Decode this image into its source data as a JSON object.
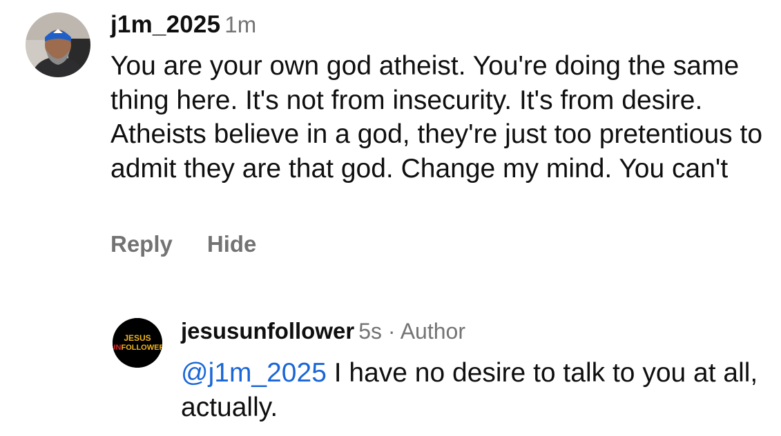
{
  "comments": [
    {
      "username": "j1m_2025",
      "time": "1m",
      "text": "You are your own god atheist. You're doing the same thing here. It's not from insecurity. It's from desire. Atheists believe in a god, they're just too pretentious to admit they are that god. Change my mind. You can't",
      "actions": {
        "reply": "Reply",
        "hide": "Hide"
      }
    }
  ],
  "reply": {
    "username": "jesusunfollower",
    "time": "5s",
    "separator": "·",
    "author_badge": "Author",
    "mention": "@j1m_2025",
    "text": " I have no desire to talk to you at all, actually.",
    "avatar_logo": {
      "line1": "JESUS",
      "line2_accent": "UN",
      "line2_rest": "FOLLOWER"
    }
  },
  "colors": {
    "text": "#0f0f0f",
    "muted": "#737373",
    "mention": "#1a66d6",
    "logo_yellow": "#f2b51f",
    "logo_red": "#e0262b"
  }
}
